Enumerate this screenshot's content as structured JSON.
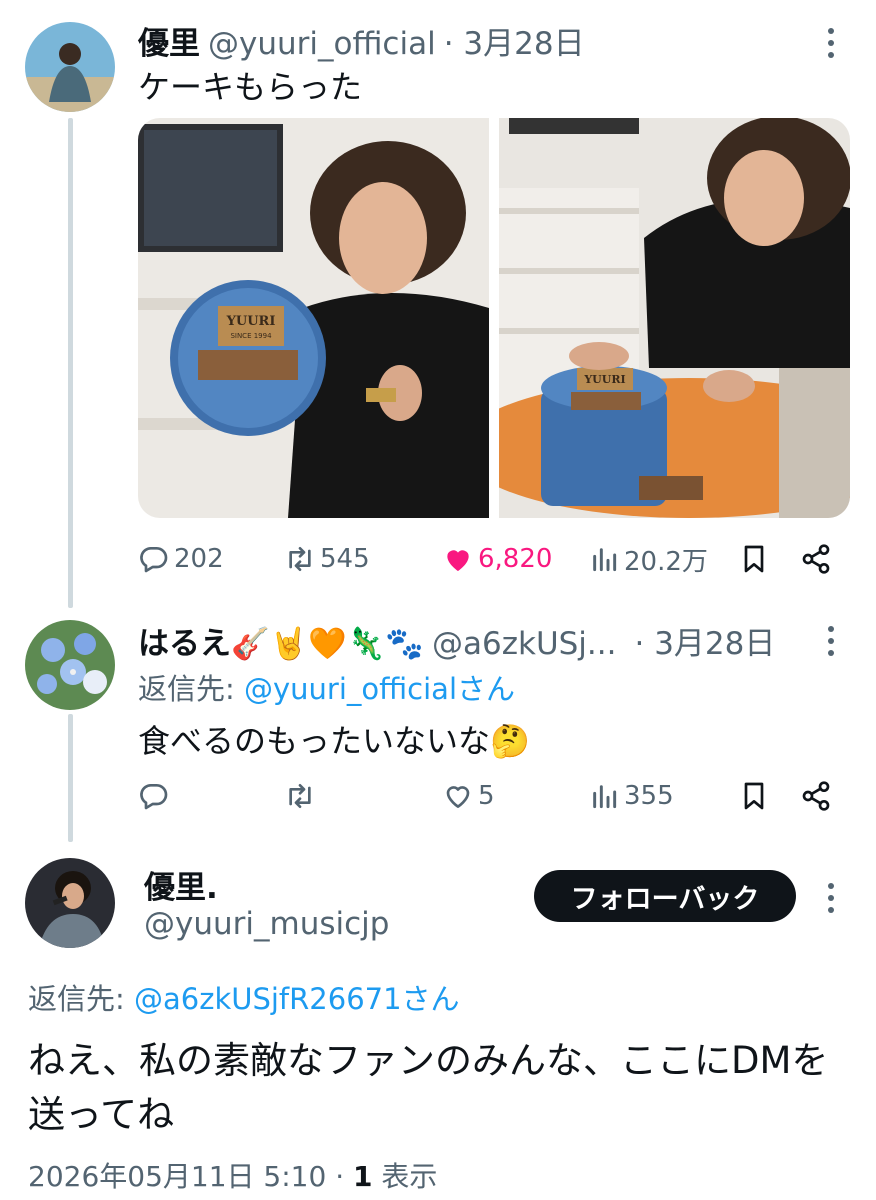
{
  "tweet1": {
    "name": "優里",
    "handle": "@yuuri_official",
    "date": "· 3月28日",
    "text": "ケーキもらった",
    "photo1_plate_text": "YUURI",
    "photo1_plate_sub": "SINCE 1994",
    "photo2_plate_text": "YUURI",
    "actions": {
      "replies": "202",
      "retweets": "545",
      "likes": "6,820",
      "views": "20.2万"
    }
  },
  "tweet2": {
    "name": "はるえ🎸🤘🧡🦎🐾",
    "handle": "@a6zkUSj...",
    "date": "· 3月28日",
    "replying_prefix": "返信先: ",
    "replying_to": "@yuuri_officialさん",
    "text": "食べるのもったいないな🤔",
    "actions": {
      "replies": "",
      "retweets": "",
      "likes": "5",
      "views": "355"
    }
  },
  "tweet3": {
    "name": "優里.",
    "handle": "@yuuri_musicjp",
    "follow_label": "フォローバック",
    "replying_prefix": "返信先: ",
    "replying_to": "@a6zkUSjfR26671さん",
    "text": "ねえ、私の素敵なファンのみんな、ここにDMを送ってね",
    "timestamp": "2026年05月11日 5:10 · ",
    "views_count": "1",
    "views_label": " 表示"
  },
  "colors": {
    "like": "#f91880",
    "link": "#1d9bf0",
    "secondary": "#536471",
    "button_bg": "#0f1419"
  },
  "icons": [
    "reply-icon",
    "retweet-icon",
    "like-icon",
    "views-icon",
    "bookmark-icon",
    "share-icon",
    "more-icon"
  ]
}
